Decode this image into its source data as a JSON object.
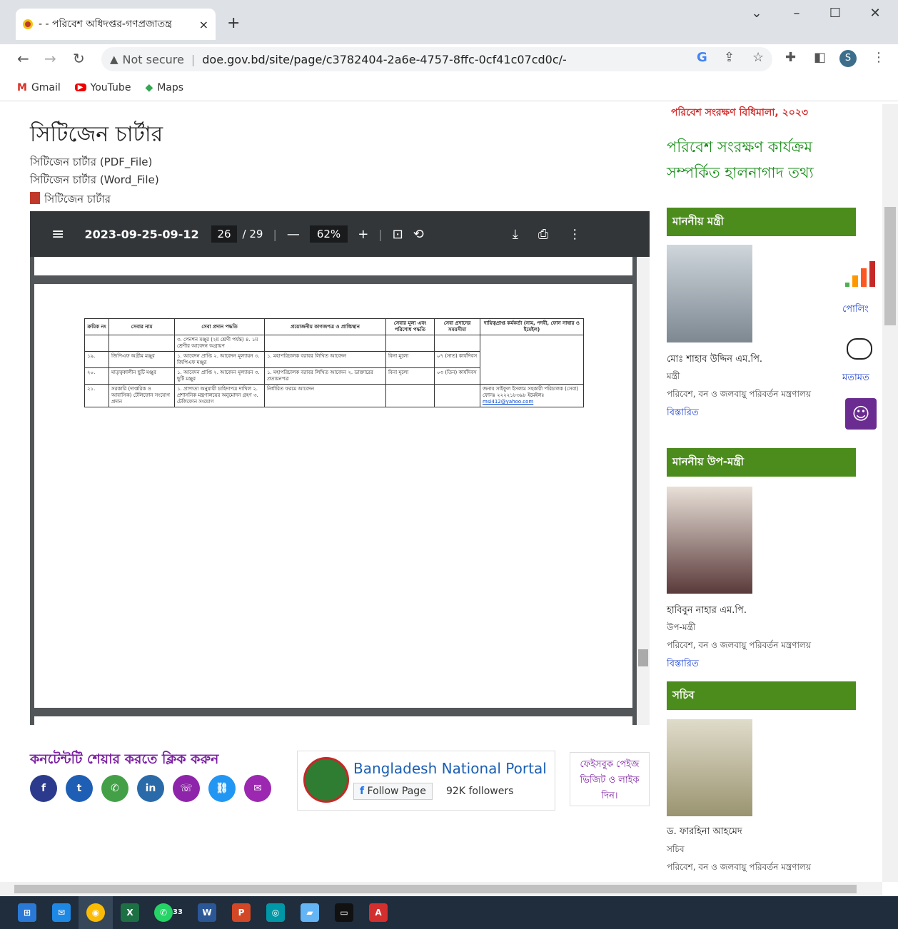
{
  "browser": {
    "tab_title": "- - পরিবেশ অধিদপ্তর-গণপ্রজাতন্ত্র",
    "tab_close": "×",
    "new_tab": "+",
    "not_secure": "Not secure",
    "url": "doe.gov.bd/site/page/c3782404-2a6e-4757-8ffc-0cf41c07cd0c/-",
    "profile_initial": "S",
    "bookmarks": [
      "Gmail",
      "YouTube",
      "Maps"
    ]
  },
  "page": {
    "title": "সিটিজেন চার্টার",
    "links": [
      "সিটিজেন চার্টার (PDF_File)",
      "সিটিজেন চার্টার (Word_File)",
      "সিটিজেন চার্টার"
    ]
  },
  "pdf": {
    "filename": "2023-09-25-09-12...",
    "page": "26",
    "total": "/ 29",
    "zoom": "62%",
    "table": {
      "headers": [
        "ক্রমিক নং",
        "সেবার নাম",
        "সেবা প্রদান পদ্ধতি",
        "প্রয়োজনীয় কাগজপত্র ও প্রাপ্তিস্থান",
        "সেবার মূল্য এবং পরিশোধ পদ্ধতি",
        "সেবা প্রদানের সময়সীমা",
        "দায়িত্বপ্রাপ্ত কর্মকর্তা (নাম, পদবী, ফোন নাম্বার ও ইমেইল)"
      ],
      "rows": [
        {
          "no": "",
          "name": "",
          "method": "৩. পেনশন মঞ্জুর (২য় শ্রেণী পর্যন্ত) ৪. ১ম শ্রেণীর আবেদন অগ্রায়ণ",
          "docs": "",
          "fee": "",
          "time": "",
          "officer": ""
        },
        {
          "no": "১৯.",
          "name": "জিপিএফ অগ্রীম মঞ্জুর",
          "method": "১. আবেদন প্রাপ্তি ২. আবেদন মূল্যায়ন ৩. জিপিএফ মঞ্জুর",
          "docs": "১. মহাপরিচালক বরাবর লিখিত আবেদন",
          "fee": "বিনা মূল্যে",
          "time": "০৭ (সাত) কার্যদিবস",
          "officer": ""
        },
        {
          "no": "২০.",
          "name": "মাতৃত্বকালীন ছুটি মঞ্জুর",
          "method": "১. আবেদন প্রাপ্তি ২. আবেদন মূল্যায়ন ৩. ছুটি মঞ্জুর",
          "docs": "১. মহাপরিচালক বরাবর লিখিত আবেদন ২. ডাক্তারের প্রত্যয়নপত্র",
          "fee": "বিনা মূল্যে",
          "time": "০৩ (তিন) কার্যদিবস",
          "officer": ""
        },
        {
          "no": "২১.",
          "name": "সরকারি (দাপ্তরিক ও আবাসিক) টেলিফোন সংযোগ প্রদান",
          "method": "১. প্রাপ্যতা অনুযায়ী চাহিদাপত্র দাখিল ২. প্রশাসনিক মন্ত্রণালয়ের অনুমোদন গ্রহণ ৩. টেলিফোন সংযোগ",
          "docs": "নির্ধারিত ফরমে আবেদন",
          "fee": "",
          "time": "",
          "officer": "জনাব সাইফুল ইসলাম সহকারী পরিচালক (সেবা) ফোনঃ ২২২২১৮৩৯৮ ইমেইলঃ"
        }
      ],
      "email": "msi412@yahoo.com"
    }
  },
  "sidebar": {
    "rules_link": "পরিবেশ সংরক্ষণ বিধিমালা, ২০২৩",
    "update_info": "পরিবেশ সংরক্ষণ কার্যক্রম সম্পর্কিত হালনাগাদ তথ্য",
    "minister": {
      "header": "মাননীয় মন্ত্রী",
      "name": "মোঃ শাহাব উদ্দিন এম.পি.",
      "role": "মন্ত্রী",
      "ministry": "পরিবেশ, বন ও জলবায়ু পরিবর্তন মন্ত্রণালয়",
      "details": "বিস্তারিত"
    },
    "deputy": {
      "header": "মাননীয় উপ-মন্ত্রী",
      "name": "হাবিবুন নাহার এম.পি.",
      "role": "উপ-মন্ত্রী",
      "ministry": "পরিবেশ, বন ও জলবায়ু পরিবর্তন মন্ত্রণালয়",
      "details": "বিস্তারিত"
    },
    "secretary": {
      "header": "সচিব",
      "name": "ড. ফারহিনা আহমেদ",
      "role": "সচিব",
      "ministry": "পরিবেশ, বন ও জলবায়ু পরিবর্তন মন্ত্রণালয়"
    },
    "poll_label": "পোলিং",
    "feedback_label": "মতামত"
  },
  "share": {
    "title": "কনটেন্টটি শেয়ার করতে ক্লিক করুন",
    "portal_name": "Bangladesh National Portal",
    "follow": "Follow Page",
    "followers": "92K followers",
    "fb_visit": "ফেইসবুক পেইজ ভিজিট ও লাইক দিন।"
  },
  "taskbar": {
    "whatsapp_badge": "33"
  },
  "colors": {
    "green": "#4c8c1c",
    "purple": "#7b1fa2"
  }
}
